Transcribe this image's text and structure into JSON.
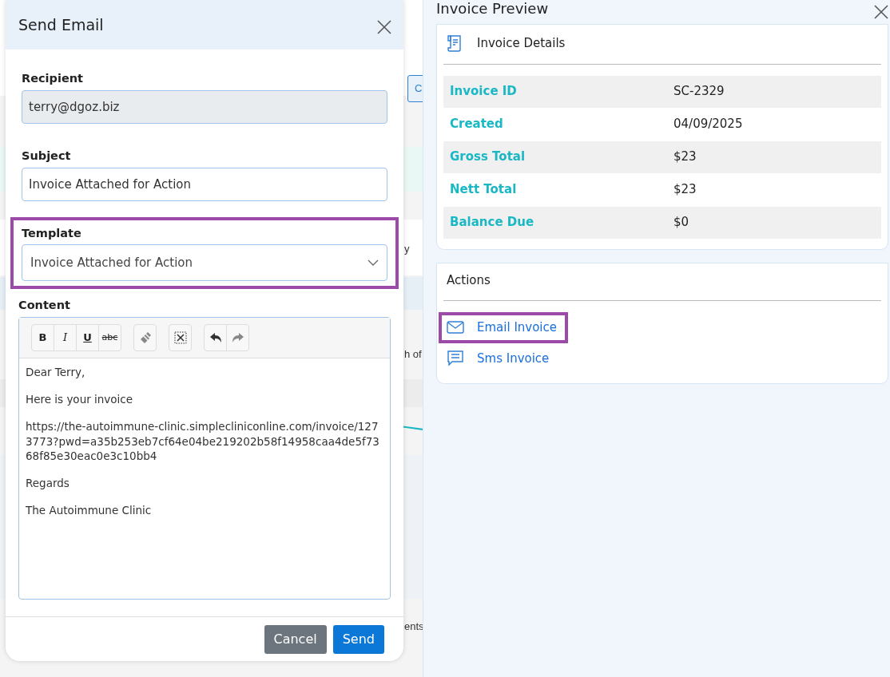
{
  "background": {
    "fragments": [
      {
        "kind": "button",
        "text": "C"
      },
      {
        "kind": "text",
        "text": "y"
      },
      {
        "kind": "text",
        "text": "h of"
      },
      {
        "kind": "text",
        "text": "ents"
      }
    ]
  },
  "modal": {
    "title": "Send Email",
    "fields": [
      {
        "kind": "readonly",
        "label": "Recipient",
        "value": "terry@dgoz.biz",
        "highlighted": false
      },
      {
        "kind": "input",
        "label": "Subject",
        "value": "Invoice Attached for Action",
        "highlighted": false
      },
      {
        "kind": "select",
        "label": "Template",
        "value": "Invoice Attached for Action",
        "highlighted": true
      }
    ],
    "content": {
      "label": "Content",
      "toolbar": [
        {
          "kind": "bold",
          "text": "B"
        },
        {
          "kind": "italic",
          "text": "I"
        },
        {
          "kind": "underline",
          "text": "U"
        },
        {
          "kind": "strike",
          "text": "abc"
        },
        {
          "kind": "eraser"
        },
        {
          "kind": "fullscreen"
        },
        {
          "kind": "undo"
        },
        {
          "kind": "redo"
        }
      ],
      "paragraphs": [
        "Dear Terry,",
        "Here is your invoice",
        "https://the-autoimmune-clinic.simplecliniconline.com/invoice/1273773?pwd=a35b253eb7cf64e04be219202b58f14958caa4de5f7368f85e30eac0e3c10bb4",
        "Regards",
        "The Autoimmune Clinic"
      ]
    },
    "buttons": [
      {
        "kind": "secondary",
        "label": "Cancel"
      },
      {
        "kind": "primary",
        "label": "Send"
      }
    ]
  },
  "preview": {
    "title": "Invoice Preview",
    "details": {
      "title": "Invoice Details",
      "rows": [
        {
          "label": "Invoice ID",
          "value": "SC-2329"
        },
        {
          "label": "Created",
          "value": "04/09/2025"
        },
        {
          "label": "Gross Total",
          "value": "$23"
        },
        {
          "label": "Nett Total",
          "value": "$23"
        },
        {
          "label": "Balance Due",
          "value": "$0"
        }
      ]
    },
    "actions": {
      "title": "Actions",
      "items": [
        {
          "kind": "email",
          "label": "Email Invoice",
          "highlighted": true
        },
        {
          "kind": "sms",
          "label": "Sms Invoice",
          "highlighted": false
        }
      ]
    }
  }
}
